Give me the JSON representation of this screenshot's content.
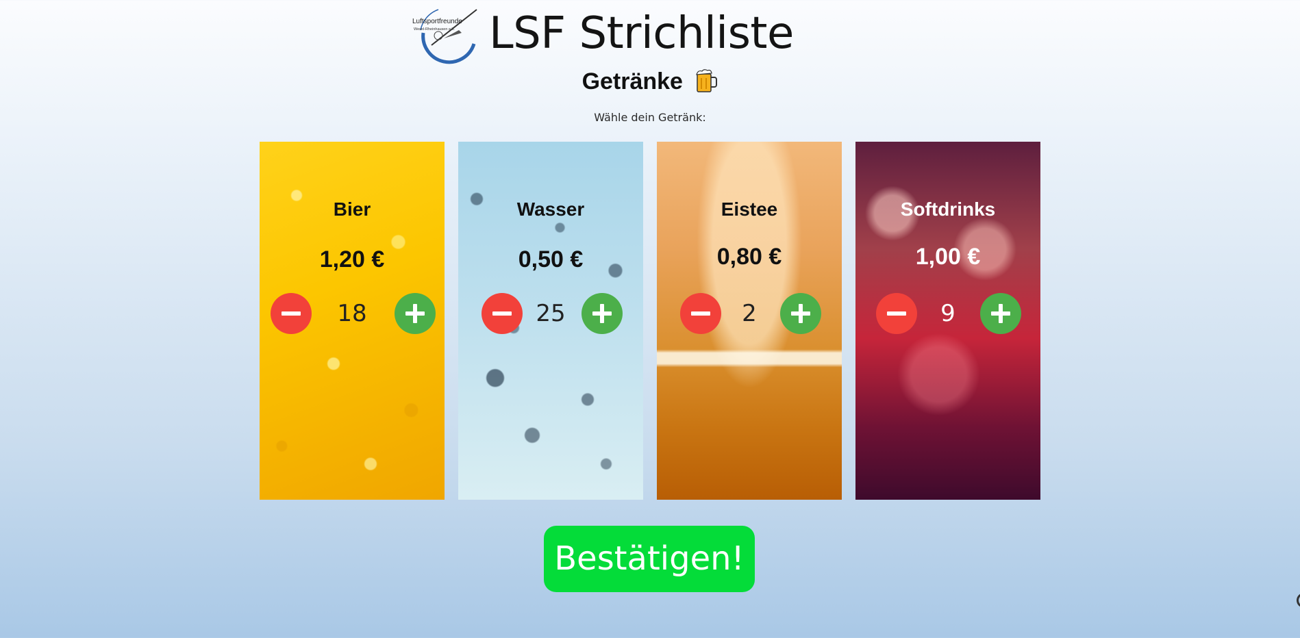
{
  "header": {
    "logo_text": "Luftsportfreunde",
    "logo_subtext": "Wesel-Rheinhausen e.V.",
    "app_title": "LSF Strichliste",
    "page_heading": "Getränke",
    "heading_icon": "beer-mug-icon",
    "subtitle": "Wähle dein Getränk:"
  },
  "drinks": [
    {
      "name": "Bier",
      "price": "1,20 €",
      "count": "18"
    },
    {
      "name": "Wasser",
      "price": "0,50 €",
      "count": "25"
    },
    {
      "name": "Eistee",
      "price": "0,80 €",
      "count": "2"
    },
    {
      "name": "Softdrinks",
      "price": "1,00 €",
      "count": "9"
    }
  ],
  "actions": {
    "confirm_label": "Bestätigen!"
  },
  "colors": {
    "minus_button": "#f2413a",
    "plus_button": "#4caf4a",
    "confirm_button": "#04dc39"
  }
}
